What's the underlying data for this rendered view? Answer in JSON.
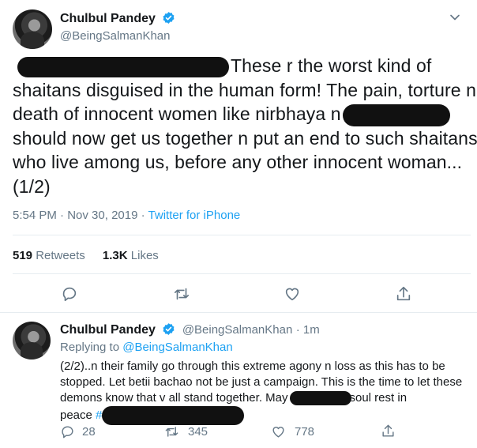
{
  "main_tweet": {
    "author_name": "Chulbul Pandey",
    "author_handle": "@BeingSalmanKhan",
    "text_lines": [
      "These r the worst kind of",
      "shaitans disguised in the human form! The pain, torture n",
      "death of innocent women like nirbhaya n",
      "should now get us together n put an end to such shaitans",
      "who live among us, before any other innocent woman...",
      "(1/2)"
    ],
    "time": "5:54 PM",
    "date": "Nov 30, 2019",
    "source": "Twitter for iPhone",
    "retweets_count": "519",
    "retweets_label": "Retweets",
    "likes_count": "1.3K",
    "likes_label": "Likes"
  },
  "reply_tweet": {
    "author_name": "Chulbul Pandey",
    "author_handle": "@BeingSalmanKhan",
    "time_ago": "1m",
    "replying_to_label": "Replying to",
    "replying_to_handle": "@BeingSalmanKhan",
    "text_1": "(2/2)..n their family go through this extreme agony n loss as this has to be stopped. Let betii bachao not be just a campaign. This is the time to let these demons know that v all stand together. May",
    "text_2": "soul rest in",
    "text_3": "peace",
    "hash_symbol": "#",
    "replies_count": "28",
    "retweets_count": "345",
    "likes_count": "778"
  },
  "colors": {
    "accent": "#1da1f2",
    "secondary_text": "#657786",
    "primary_text": "#14171a",
    "divider": "#e6ecf0"
  },
  "icons": [
    "verified-badge-icon",
    "chevron-down-icon",
    "reply-icon",
    "retweet-icon",
    "like-icon",
    "share-icon"
  ]
}
